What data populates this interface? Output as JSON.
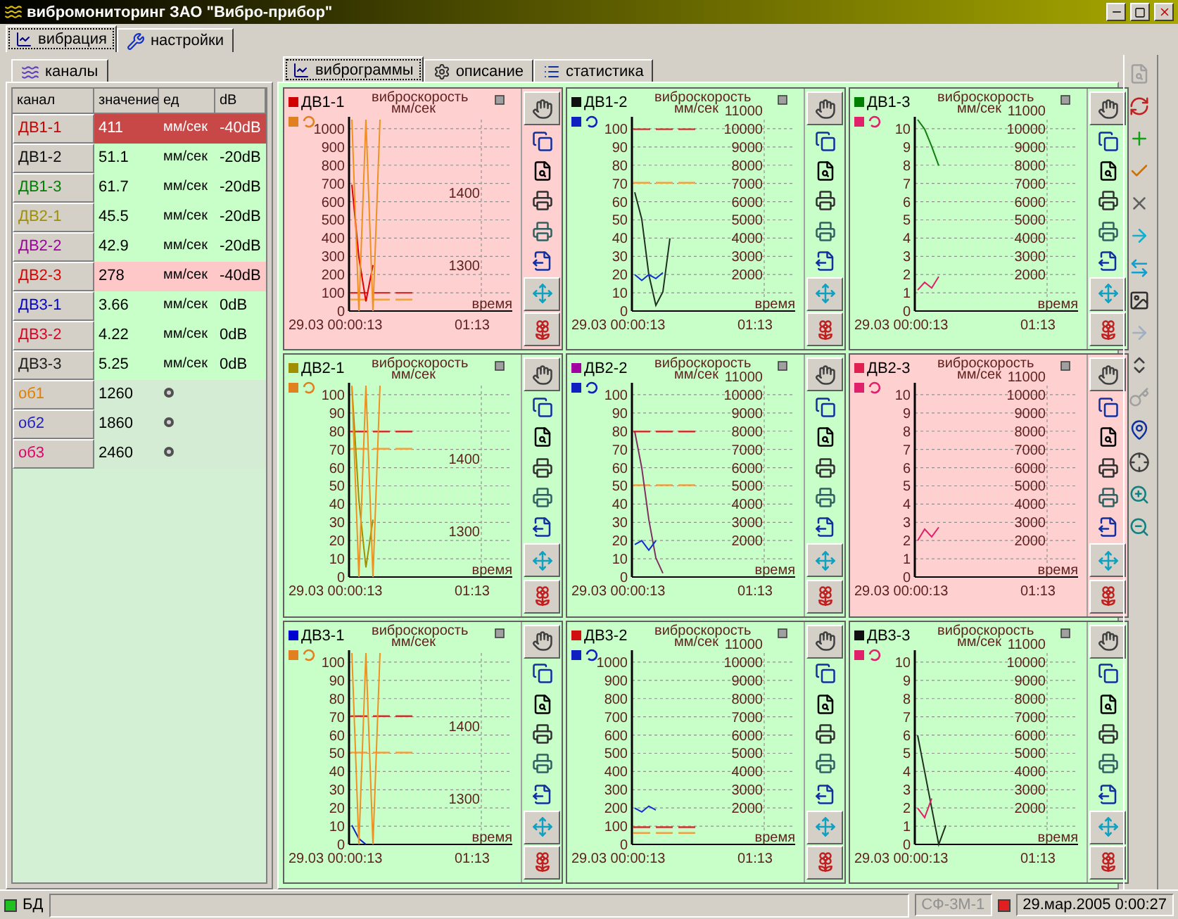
{
  "window": {
    "title": "вибромониторинг ЗАО \"Вибро-прибор\""
  },
  "main_tabs": [
    {
      "label": "вибрация",
      "selected": true
    },
    {
      "label": "настройки",
      "selected": false
    }
  ],
  "left_panel": {
    "tab": "каналы",
    "columns": [
      "канал",
      "значение",
      "ед",
      "dB"
    ],
    "rows": [
      {
        "kind": "channel",
        "name": "ДВ1-1",
        "color": "#d00000",
        "value": "411",
        "unit": "мм/сек",
        "db": "-40dB",
        "alarm": true,
        "selected": true
      },
      {
        "kind": "channel",
        "name": "ДВ1-2",
        "color": "#101010",
        "value": "51.1",
        "unit": "мм/сек",
        "db": "-20dB",
        "alarm": false,
        "selected": false
      },
      {
        "kind": "channel",
        "name": "ДВ1-3",
        "color": "#008000",
        "value": "61.7",
        "unit": "мм/сек",
        "db": "-20dB",
        "alarm": false,
        "selected": false
      },
      {
        "kind": "channel",
        "name": "ДВ2-1",
        "color": "#a09000",
        "value": "45.5",
        "unit": "мм/сек",
        "db": "-20dB",
        "alarm": false,
        "selected": false
      },
      {
        "kind": "channel",
        "name": "ДВ2-2",
        "color": "#a000a0",
        "value": "42.9",
        "unit": "мм/сек",
        "db": "-20dB",
        "alarm": false,
        "selected": false
      },
      {
        "kind": "channel",
        "name": "ДВ2-3",
        "color": "#e00000",
        "value": "278",
        "unit": "мм/сек",
        "db": "-40dB",
        "alarm": true,
        "selected": false
      },
      {
        "kind": "channel",
        "name": "ДВ3-1",
        "color": "#0000d0",
        "value": "3.66",
        "unit": "мм/сек",
        "db": "0dB",
        "alarm": false,
        "selected": false
      },
      {
        "kind": "channel",
        "name": "ДВ3-2",
        "color": "#e00020",
        "value": "4.22",
        "unit": "мм/сек",
        "db": "0dB",
        "alarm": false,
        "selected": false
      },
      {
        "kind": "channel",
        "name": "ДВ3-3",
        "color": "#202020",
        "value": "5.25",
        "unit": "мм/сек",
        "db": "0dB",
        "alarm": false,
        "selected": false
      },
      {
        "kind": "object",
        "name": "об1",
        "color": "#e08000",
        "value": "1260",
        "alarm": false,
        "selected": false
      },
      {
        "kind": "object",
        "name": "об2",
        "color": "#2020c0",
        "value": "1860",
        "alarm": false,
        "selected": false
      },
      {
        "kind": "object",
        "name": "об3",
        "color": "#e0006a",
        "value": "2460",
        "alarm": false,
        "selected": false
      }
    ]
  },
  "chart_tabs": [
    {
      "label": "виброграммы",
      "selected": true
    },
    {
      "label": "описание",
      "selected": false
    },
    {
      "label": "статистика",
      "selected": false
    }
  ],
  "panels": [
    {
      "legend": [
        {
          "label": "ДВ1-1",
          "color": "#d00000"
        },
        {
          "color": "#e08020"
        }
      ],
      "alarm": true,
      "title": "виброскорость",
      "unit": "мм/сек",
      "time_label": "время",
      "x_start": "29.03 00:00:13",
      "x_end": "01:13",
      "y_ticks": [
        "1000",
        "900",
        "800",
        "700",
        "600",
        "500",
        "400",
        "300",
        "200",
        "100",
        "0"
      ],
      "right_ticks": [
        "1400",
        "1300"
      ]
    },
    {
      "legend": [
        {
          "label": "ДВ1-2",
          "color": "#101010"
        },
        {
          "color": "#1020c0"
        }
      ],
      "alarm": false,
      "title": "виброскорость",
      "unit": "мм/сек",
      "time_label": "время",
      "x_start": "29.03 00:00:13",
      "x_end": "01:13",
      "y_ticks": [
        "100",
        "90",
        "80",
        "70",
        "60",
        "50",
        "40",
        "30",
        "20",
        "10",
        "0"
      ],
      "right_ticks": [
        "11000",
        "10000",
        "9000",
        "8000",
        "7000",
        "6000",
        "5000",
        "4000",
        "3000",
        "2000"
      ]
    },
    {
      "legend": [
        {
          "label": "ДВ1-3",
          "color": "#008000"
        },
        {
          "color": "#e0206a"
        }
      ],
      "alarm": false,
      "title": "виброскорость",
      "unit": "мм/сек",
      "time_label": "время",
      "x_start": "29.03 00:00:13",
      "x_end": "01:13",
      "y_ticks": [
        "10",
        "9",
        "8",
        "7",
        "6",
        "5",
        "4",
        "3",
        "2",
        "1",
        "0"
      ],
      "right_ticks": [
        "11000",
        "10000",
        "9000",
        "8000",
        "7000",
        "6000",
        "5000",
        "4000",
        "3000",
        "2000"
      ]
    },
    {
      "legend": [
        {
          "label": "ДВ2-1",
          "color": "#a09000"
        },
        {
          "color": "#e08020"
        }
      ],
      "alarm": false,
      "title": "виброскорость",
      "unit": "мм/сек",
      "time_label": "время",
      "x_start": "29.03 00:00:13",
      "x_end": "01:13",
      "y_ticks": [
        "100",
        "90",
        "80",
        "70",
        "60",
        "50",
        "40",
        "30",
        "20",
        "10",
        "0"
      ],
      "right_ticks": [
        "1400",
        "1300"
      ]
    },
    {
      "legend": [
        {
          "label": "ДВ2-2",
          "color": "#a000a0"
        },
        {
          "color": "#1020c0"
        }
      ],
      "alarm": false,
      "title": "виброскорость",
      "unit": "мм/сек",
      "time_label": "время",
      "x_start": "29.03 00:00:13",
      "x_end": "01:13",
      "y_ticks": [
        "100",
        "90",
        "80",
        "70",
        "60",
        "50",
        "40",
        "30",
        "20",
        "10",
        "0"
      ],
      "right_ticks": [
        "11000",
        "10000",
        "9000",
        "8000",
        "7000",
        "6000",
        "5000",
        "4000",
        "3000",
        "2000"
      ]
    },
    {
      "legend": [
        {
          "label": "ДВ2-3",
          "color": "#e02050"
        },
        {
          "color": "#e0206a"
        }
      ],
      "alarm": true,
      "title": "виброскорость",
      "unit": "мм/сек",
      "time_label": "время",
      "x_start": "29.03 00:00:13",
      "x_end": "01:13",
      "y_ticks": [
        "10",
        "9",
        "8",
        "7",
        "6",
        "5",
        "4",
        "3",
        "2",
        "1",
        "0"
      ],
      "right_ticks": [
        "11000",
        "10000",
        "9000",
        "8000",
        "7000",
        "6000",
        "5000",
        "4000",
        "3000",
        "2000"
      ]
    },
    {
      "legend": [
        {
          "label": "ДВ3-1",
          "color": "#0000d0"
        },
        {
          "color": "#e08020"
        }
      ],
      "alarm": false,
      "title": "виброскорость",
      "unit": "мм/сек",
      "time_label": "время",
      "x_start": "29.03 00:00:13",
      "x_end": "01:13",
      "y_ticks": [
        "100",
        "90",
        "80",
        "70",
        "60",
        "50",
        "40",
        "30",
        "20",
        "10",
        "0"
      ],
      "right_ticks": [
        "1400",
        "1300"
      ]
    },
    {
      "legend": [
        {
          "label": "ДВ3-2",
          "color": "#d01010"
        },
        {
          "color": "#1020c0"
        }
      ],
      "alarm": false,
      "title": "виброскорость",
      "unit": "мм/сек",
      "time_label": "время",
      "x_start": "29.03 00:00:13",
      "x_end": "01:13",
      "y_ticks": [
        "1000",
        "900",
        "800",
        "700",
        "600",
        "500",
        "400",
        "300",
        "200",
        "100",
        "0"
      ],
      "right_ticks": [
        "11000",
        "10000",
        "9000",
        "8000",
        "7000",
        "6000",
        "5000",
        "4000",
        "3000",
        "2000"
      ]
    },
    {
      "legend": [
        {
          "label": "ДВ3-3",
          "color": "#101010"
        },
        {
          "color": "#e0206a"
        }
      ],
      "alarm": false,
      "title": "виброскорость",
      "unit": "мм/сек",
      "time_label": "время",
      "x_start": "29.03 00:00:13",
      "x_end": "01:13",
      "y_ticks": [
        "10",
        "9",
        "8",
        "7",
        "6",
        "5",
        "4",
        "3",
        "2",
        "1",
        "0"
      ],
      "right_ticks": [
        "11000",
        "10000",
        "9000",
        "8000",
        "7000",
        "6000",
        "5000",
        "4000",
        "3000",
        "2000"
      ]
    }
  ],
  "status_bar": {
    "db_label": "БД",
    "db_ok": true,
    "device": "СФ-3М-1",
    "device_alarm": true,
    "datetime": "29.мар.2005 0:00:27"
  }
}
